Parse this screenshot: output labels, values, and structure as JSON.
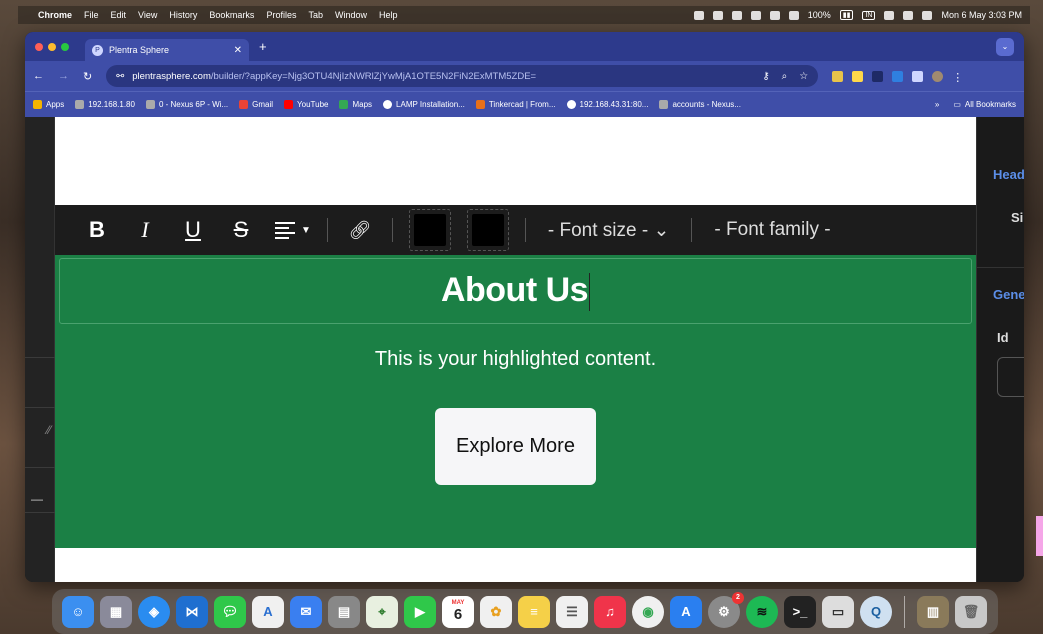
{
  "menubar": {
    "app": "Chrome",
    "items": [
      "File",
      "Edit",
      "View",
      "History",
      "Bookmarks",
      "Profiles",
      "Tab",
      "Window",
      "Help"
    ],
    "battery": "100%",
    "input_source": "IN",
    "datetime": "Mon 6 May  3:03 PM"
  },
  "browser": {
    "tab_title": "Plentra Sphere",
    "url_host": "plentrasphere.com",
    "url_path": "/builder/?appKey=Njg3OTU4NjIzNWRlZjYwMjA1OTE5N2FiN2ExMTM5ZDE=",
    "bookmarks": [
      {
        "label": "Apps",
        "color": "#f4b400"
      },
      {
        "label": "192.168.1.80",
        "color": "#aaaaaa"
      },
      {
        "label": "0 - Nexus 6P - Wi...",
        "color": "#aaaaaa"
      },
      {
        "label": "Gmail",
        "color": "#ea4335"
      },
      {
        "label": "YouTube",
        "color": "#ff0000"
      },
      {
        "label": "Maps",
        "color": "#34a853"
      },
      {
        "label": "LAMP Installation...",
        "color": "#ffffff"
      },
      {
        "label": "Tinkercad | From...",
        "color": "#e8701a"
      },
      {
        "label": "192.168.43.31:80...",
        "color": "#ffffff"
      },
      {
        "label": "accounts - Nexus...",
        "color": "#aaaaaa"
      }
    ],
    "all_bookmarks": "All Bookmarks"
  },
  "toolbar": {
    "bold": "B",
    "italic": "I",
    "underline": "U",
    "strike": "S",
    "font_size": "- Font size -",
    "font_family": "- Font family -",
    "text_color": "#000000",
    "bg_color": "#000000"
  },
  "content": {
    "heading": "About Us",
    "subtext": "This is your highlighted content.",
    "button": "Explore More",
    "section_color": "#1b8045"
  },
  "right_panel": {
    "heading_section": "Head",
    "size_label": "Si",
    "general_section": "Gene",
    "id_label": "Id"
  },
  "dock": {
    "calendar_month": "MAY",
    "calendar_day": "6",
    "settings_badge": "2"
  }
}
